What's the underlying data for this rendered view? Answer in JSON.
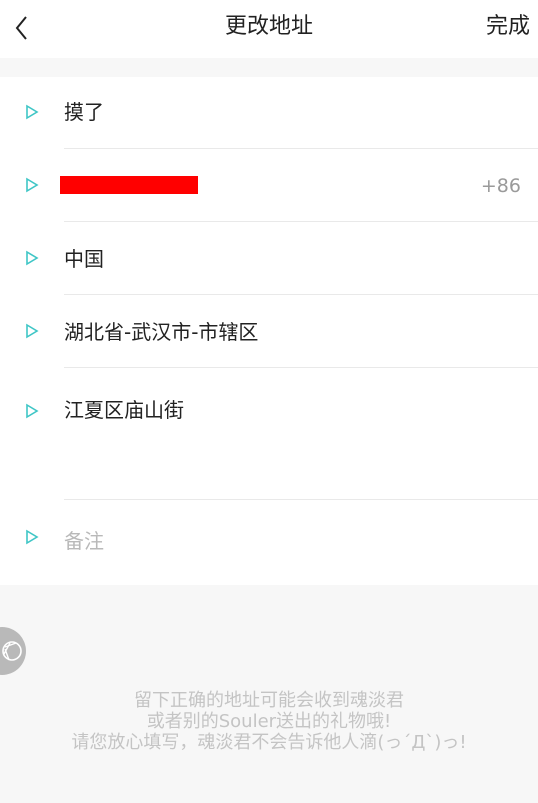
{
  "header": {
    "title": "更改地址",
    "done_label": "完成",
    "back_icon": "chevron-left-icon"
  },
  "form": {
    "name": "摸了",
    "phone_code": "+86",
    "phone_redacted": true,
    "country": "中国",
    "region": "湖北省-武汉市-市辖区",
    "street": "江夏区庙山街",
    "note_placeholder": "备注"
  },
  "footer": {
    "line1": "留下正确的地址可能会收到魂淡君",
    "line2": "或者别的Souler送出的礼物哦!",
    "line3": "请您放心填写，魂淡君不会告诉他人滴(っ´Д`)っ!"
  },
  "colors": {
    "accent": "#3fc6c6",
    "redaction": "#ff0000",
    "text": "#222222",
    "muted": "#b9b9b9"
  }
}
